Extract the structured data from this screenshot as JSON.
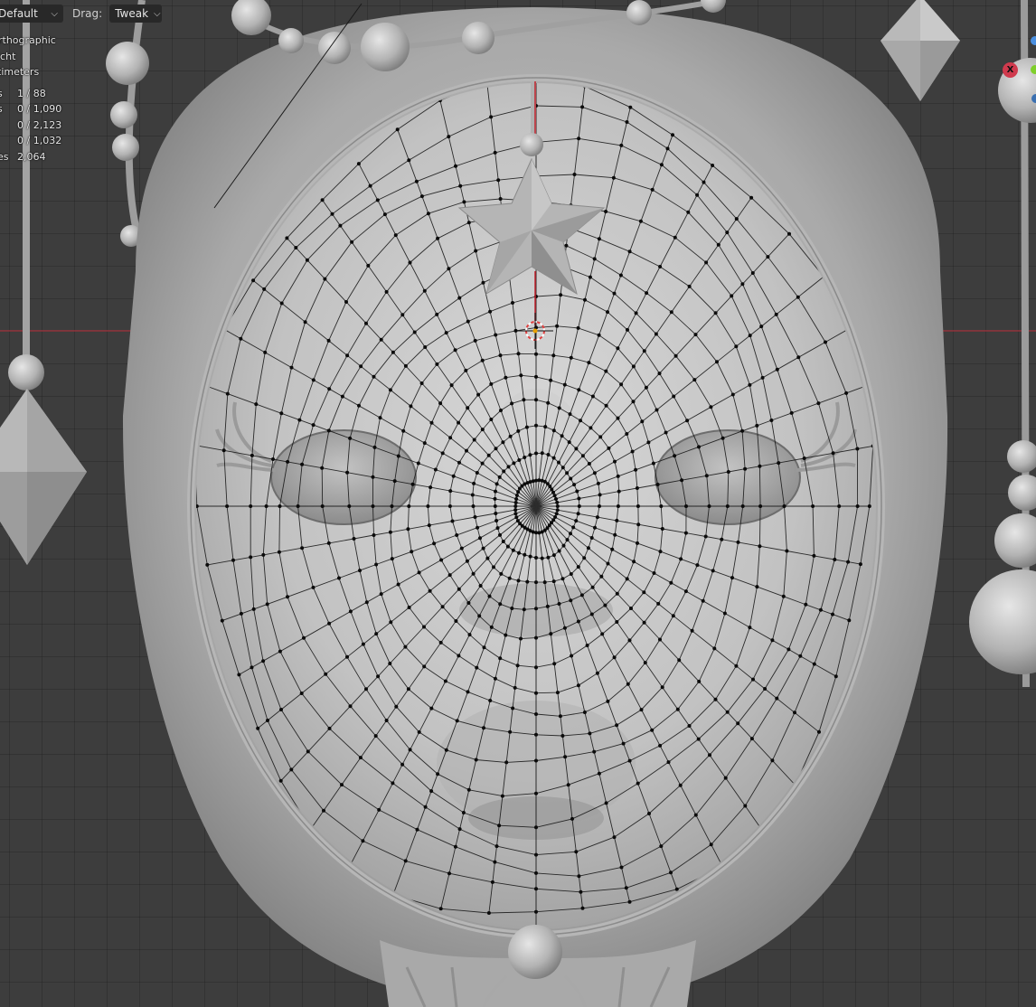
{
  "header": {
    "orientation_label": "Default",
    "drag_label": "Drag:",
    "drag_value": "Tweak"
  },
  "overlay": {
    "view_name": "rthographic",
    "collection": "icht",
    "units": "timeters"
  },
  "stats": [
    {
      "key": "s",
      "value": "1 / 88"
    },
    {
      "key": "s",
      "value": "0 / 1,090"
    },
    {
      "key": "",
      "value": "0 / 2,123"
    },
    {
      "key": "",
      "value": "0 / 1,032"
    },
    {
      "key": "es",
      "value": "2,064"
    }
  ],
  "gizmo": {
    "x_label": "X",
    "colors": {
      "x": "#d03a4d",
      "y": "#7fcf2a",
      "z": "#4a8fe0"
    }
  },
  "colors": {
    "viewport_bg": "#3d3d3d",
    "grid_line": "#353535",
    "axis_red": "#a5343f",
    "mesh_light": "#d6d6d6",
    "mesh_dark": "#6f6f6f",
    "wire": "#111111"
  }
}
